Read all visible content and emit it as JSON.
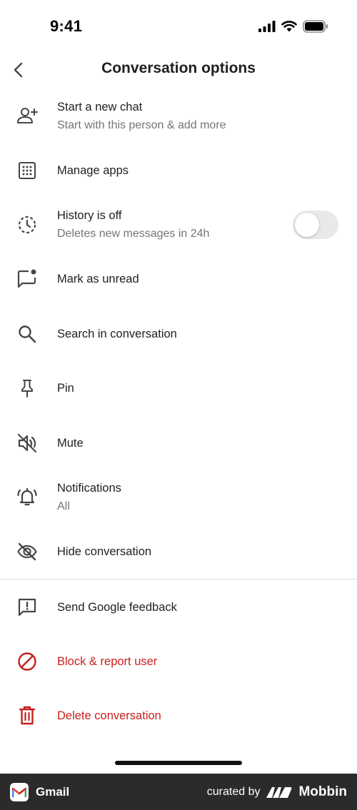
{
  "status_bar": {
    "time": "9:41"
  },
  "header": {
    "title": "Conversation options",
    "back_icon": "chevron-left-icon"
  },
  "menu": [
    {
      "id": "start-new-chat",
      "icon": "person-add-icon",
      "label": "Start a new chat",
      "sublabel": "Start with this person & add more"
    },
    {
      "id": "manage-apps",
      "icon": "apps-grid-icon",
      "label": "Manage apps"
    },
    {
      "id": "history",
      "icon": "history-clock-icon",
      "label": "History is off",
      "sublabel": "Deletes new messages in 24h",
      "toggle_on": false
    },
    {
      "id": "mark-unread",
      "icon": "mark-unread-icon",
      "label": "Mark as unread"
    },
    {
      "id": "search",
      "icon": "search-icon",
      "label": "Search in conversation"
    },
    {
      "id": "pin",
      "icon": "pin-icon",
      "label": "Pin"
    },
    {
      "id": "mute",
      "icon": "volume-off-icon",
      "label": "Mute"
    },
    {
      "id": "notifications",
      "icon": "notifications-icon",
      "label": "Notifications",
      "sublabel": "All"
    },
    {
      "id": "hide",
      "icon": "visibility-off-icon",
      "label": "Hide conversation"
    },
    {
      "id": "feedback",
      "icon": "feedback-icon",
      "label": "Send Google feedback"
    },
    {
      "id": "block",
      "icon": "block-icon",
      "label": "Block & report user",
      "color": "#c5221f"
    },
    {
      "id": "delete",
      "icon": "trash-icon",
      "label": "Delete conversation",
      "color": "#c5221f"
    }
  ],
  "footer": {
    "app_name": "Gmail",
    "curated_by": "curated by",
    "brand": "Mobbin"
  },
  "colors": {
    "danger": "#c5221f",
    "icon": "#444746",
    "secondary_text": "#757575",
    "footer_bg": "#2b2b2b"
  }
}
